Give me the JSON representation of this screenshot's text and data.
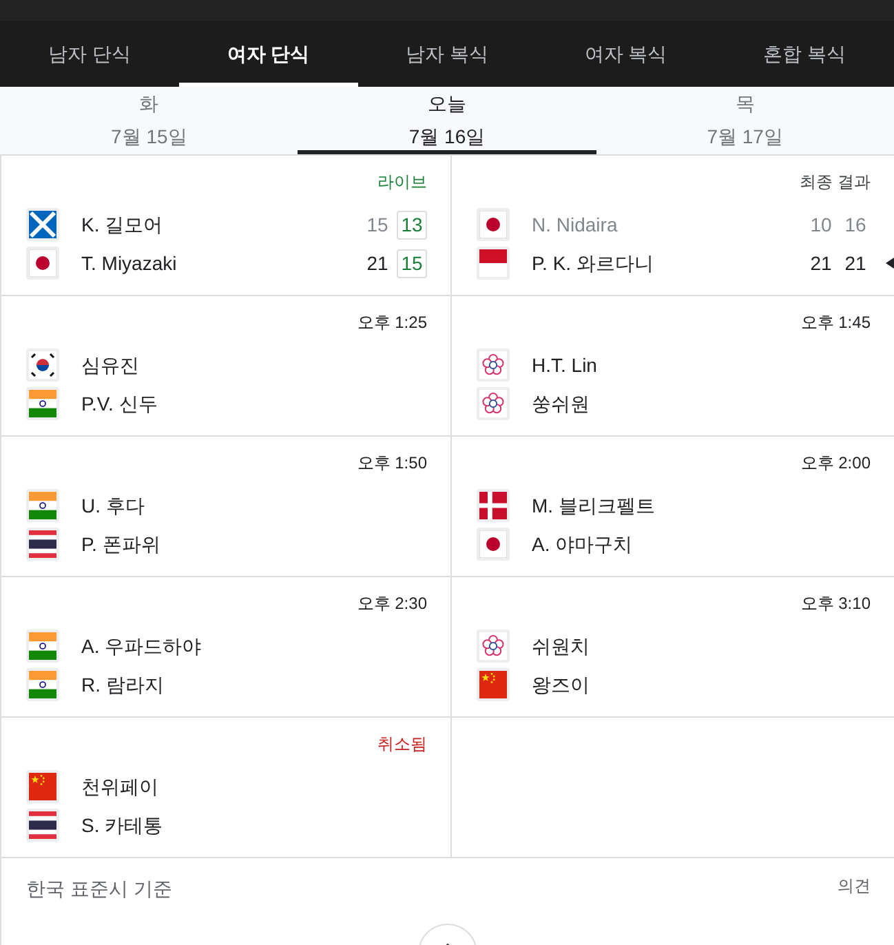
{
  "tabs": [
    {
      "label": "남자 단식",
      "selected": false
    },
    {
      "label": "여자 단식",
      "selected": true
    },
    {
      "label": "남자 복식",
      "selected": false
    },
    {
      "label": "여자 복식",
      "selected": false
    },
    {
      "label": "혼합 복식",
      "selected": false
    }
  ],
  "dates": [
    {
      "day": "화",
      "date": "7월 15일",
      "selected": false
    },
    {
      "day": "오늘",
      "date": "7월 16일",
      "selected": true
    },
    {
      "day": "목",
      "date": "7월 17일",
      "selected": false
    }
  ],
  "matches": [
    {
      "status": {
        "kind": "live",
        "text": "라이브"
      },
      "players": [
        {
          "flag": {
            "kind": "scotland"
          },
          "name": "K. 길모어",
          "lost": false,
          "winner": false,
          "scores": [
            {
              "value": "15",
              "lost": true,
              "current": false
            },
            {
              "value": "13",
              "lost": false,
              "current": true
            }
          ]
        },
        {
          "flag": {
            "kind": "japan"
          },
          "name": "T. Miyazaki",
          "lost": false,
          "winner": false,
          "scores": [
            {
              "value": "21",
              "lost": false,
              "current": false
            },
            {
              "value": "15",
              "lost": false,
              "current": true
            }
          ]
        }
      ]
    },
    {
      "status": {
        "kind": "final",
        "text": "최종 결과"
      },
      "players": [
        {
          "flag": {
            "kind": "japan"
          },
          "name": "N. Nidaira",
          "lost": true,
          "winner": false,
          "scores": [
            {
              "value": "10",
              "lost": true,
              "current": false
            },
            {
              "value": "16",
              "lost": true,
              "current": false
            }
          ]
        },
        {
          "flag": {
            "kind": "indonesia"
          },
          "name": "P. K. 와르다니",
          "lost": false,
          "winner": true,
          "scores": [
            {
              "value": "21",
              "lost": false,
              "current": false
            },
            {
              "value": "21",
              "lost": false,
              "current": false
            }
          ]
        }
      ]
    },
    {
      "status": {
        "kind": "time",
        "text": "오후 1:25"
      },
      "players": [
        {
          "flag": {
            "kind": "korea"
          },
          "name": "심유진",
          "lost": false,
          "winner": false
        },
        {
          "flag": {
            "kind": "india"
          },
          "name": "P.V. 신두",
          "lost": false,
          "winner": false
        }
      ]
    },
    {
      "status": {
        "kind": "time",
        "text": "오후 1:45"
      },
      "players": [
        {
          "flag": {
            "kind": "chinese_taipei"
          },
          "name": "H.T. Lin",
          "lost": false,
          "winner": false
        },
        {
          "flag": {
            "kind": "chinese_taipei"
          },
          "name": "쑹쉬원",
          "lost": false,
          "winner": false
        }
      ]
    },
    {
      "status": {
        "kind": "time",
        "text": "오후 1:50"
      },
      "players": [
        {
          "flag": {
            "kind": "india"
          },
          "name": "U. 후다",
          "lost": false,
          "winner": false
        },
        {
          "flag": {
            "kind": "thailand"
          },
          "name": "P. 폰파위",
          "lost": false,
          "winner": false
        }
      ]
    },
    {
      "status": {
        "kind": "time",
        "text": "오후 2:00"
      },
      "players": [
        {
          "flag": {
            "kind": "denmark"
          },
          "name": "M. 블리크펠트",
          "lost": false,
          "winner": false
        },
        {
          "flag": {
            "kind": "japan"
          },
          "name": "A. 야마구치",
          "lost": false,
          "winner": false
        }
      ]
    },
    {
      "status": {
        "kind": "time",
        "text": "오후 2:30"
      },
      "players": [
        {
          "flag": {
            "kind": "india"
          },
          "name": "A. 우파드하야",
          "lost": false,
          "winner": false
        },
        {
          "flag": {
            "kind": "india"
          },
          "name": "R. 람라지",
          "lost": false,
          "winner": false
        }
      ]
    },
    {
      "status": {
        "kind": "time",
        "text": "오후 3:10"
      },
      "players": [
        {
          "flag": {
            "kind": "chinese_taipei"
          },
          "name": "쉬원치",
          "lost": false,
          "winner": false
        },
        {
          "flag": {
            "kind": "china"
          },
          "name": "왕즈이",
          "lost": false,
          "winner": false
        }
      ]
    },
    {
      "status": {
        "kind": "cancelled",
        "text": "취소됨"
      },
      "players": [
        {
          "flag": {
            "kind": "china"
          },
          "name": "천위페이",
          "lost": false,
          "winner": false
        },
        {
          "flag": {
            "kind": "thailand"
          },
          "name": "S. 카테통",
          "lost": false,
          "winner": false
        }
      ]
    }
  ],
  "footer": {
    "timezone_note": "한국 표준시 기준",
    "feedback_link": "의견"
  }
}
